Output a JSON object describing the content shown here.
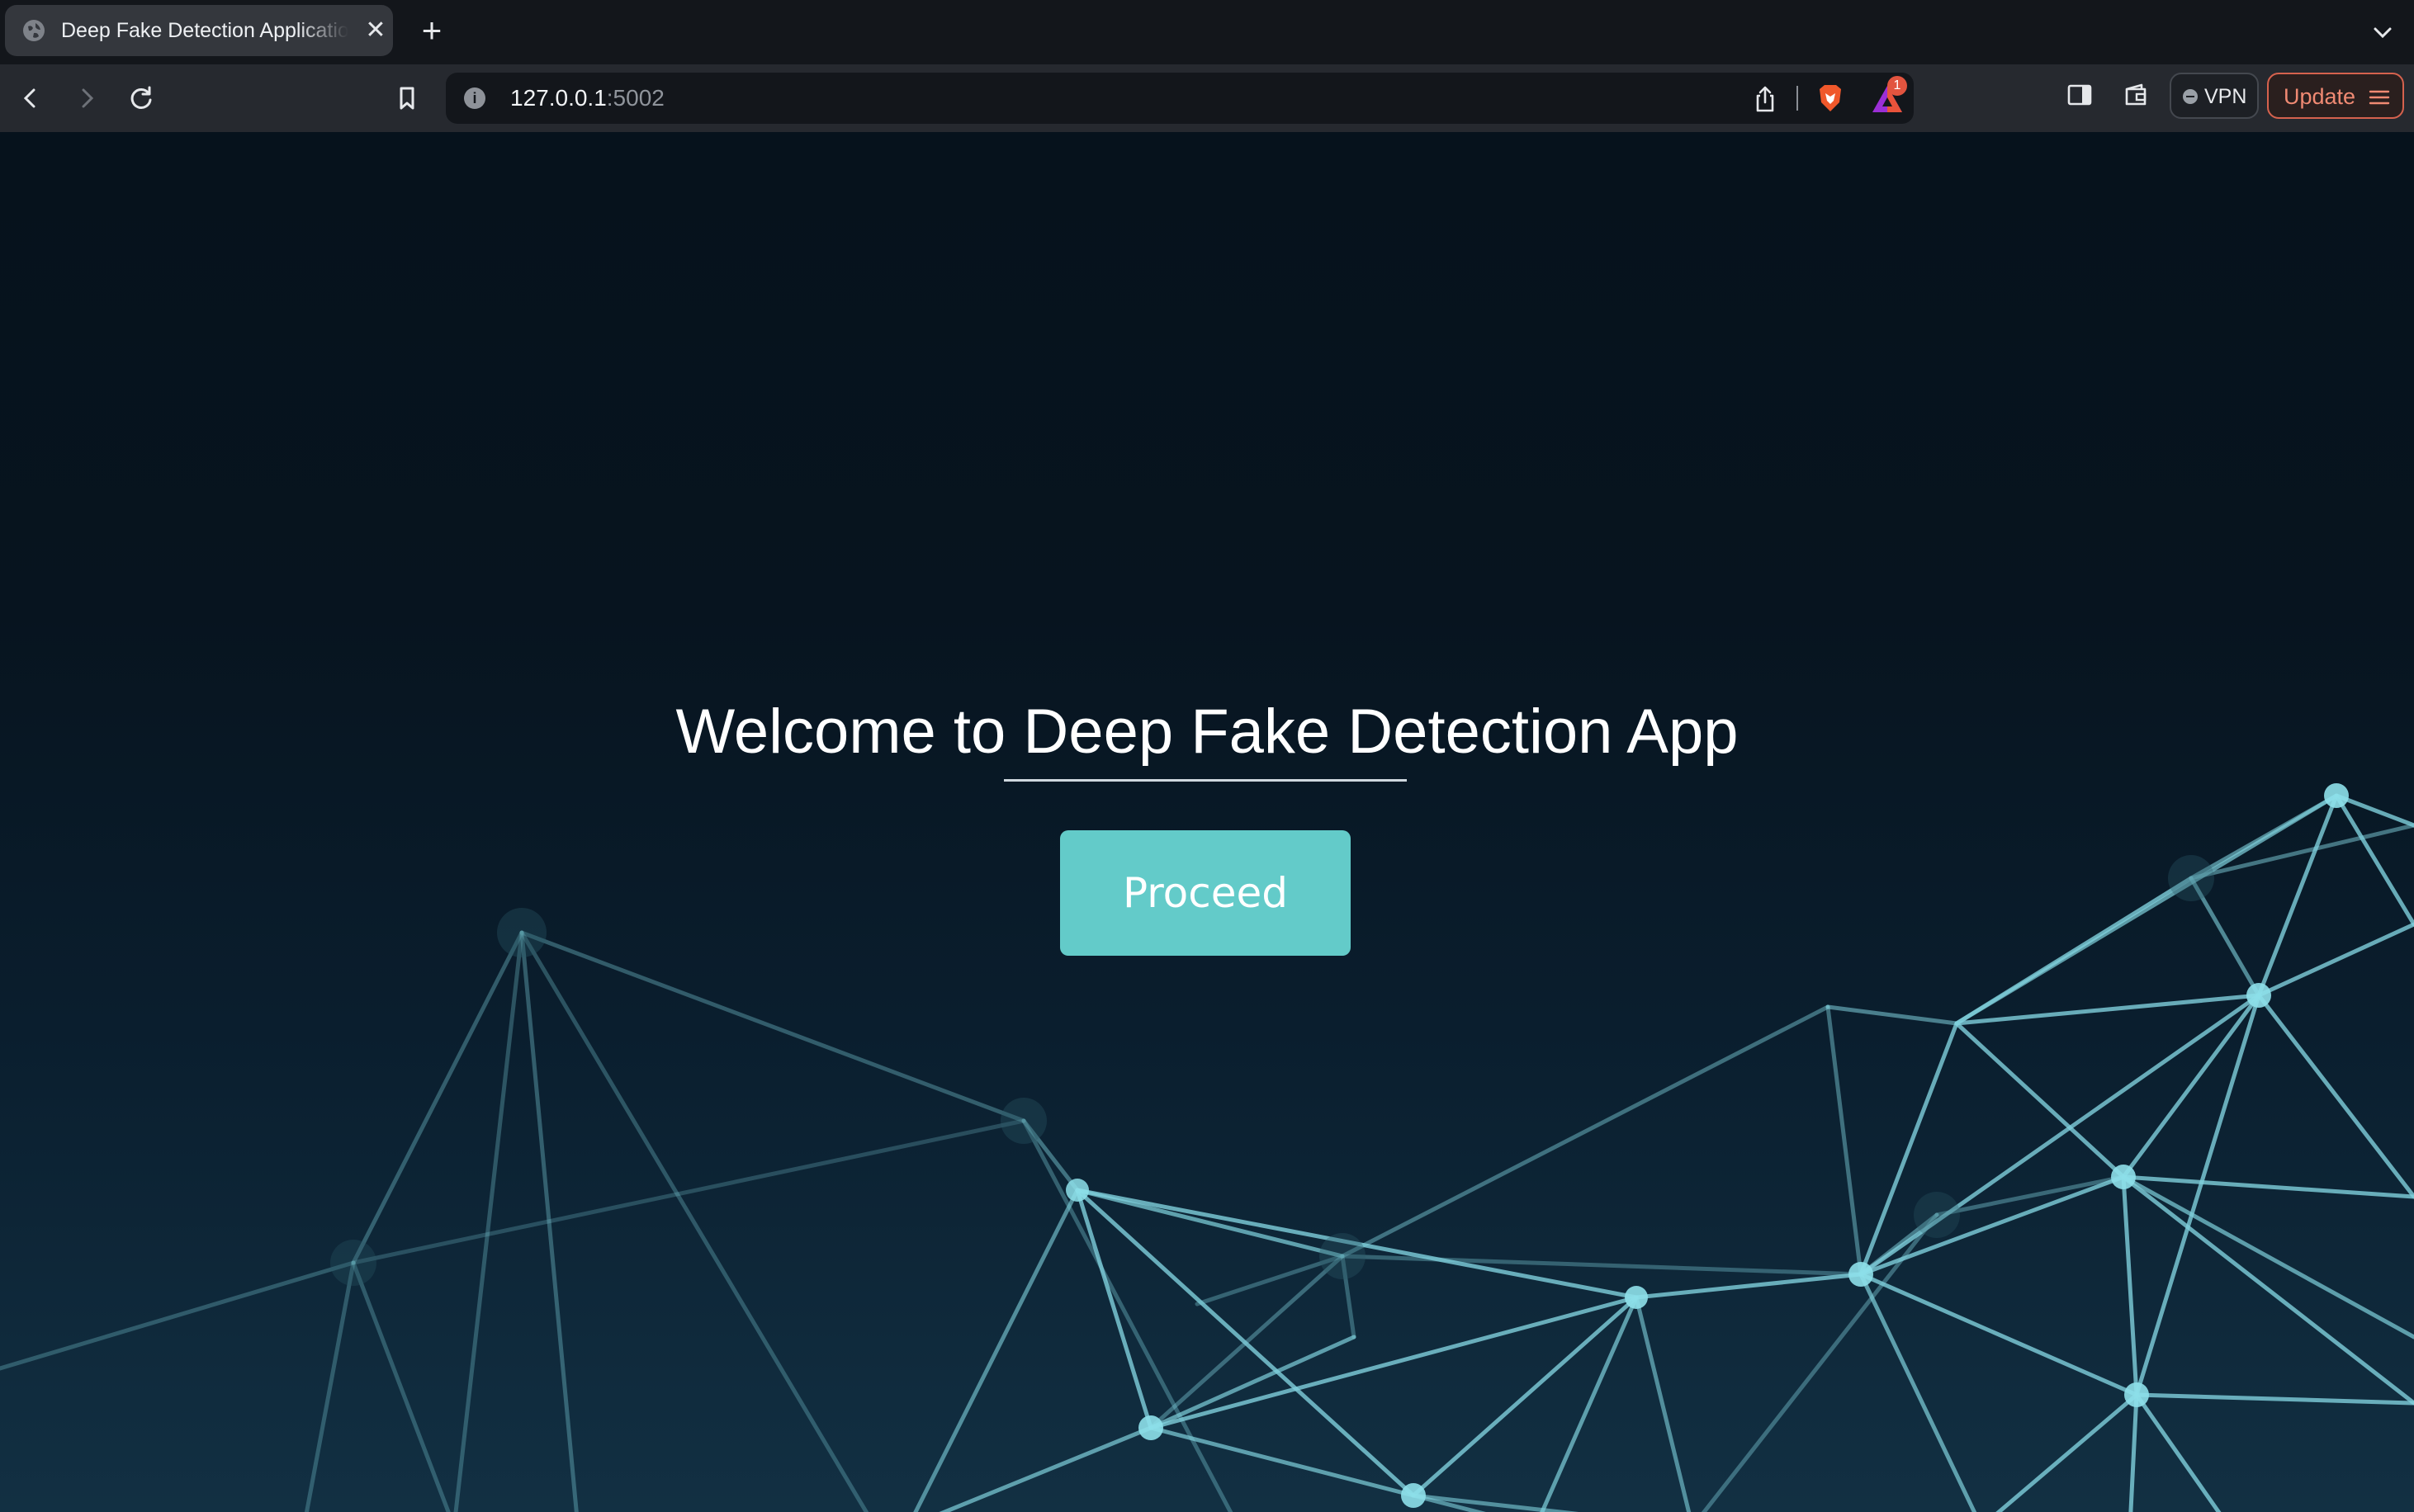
{
  "browser": {
    "tab": {
      "title": "Deep Fake Detection Application",
      "favicon_icon": "globe-icon",
      "close_icon": "close-icon"
    },
    "new_tab_icon": "plus-icon",
    "tab_list_icon": "chevron-down-icon",
    "toolbar": {
      "back_icon": "back-arrow-icon",
      "forward_icon": "forward-arrow-icon",
      "reload_icon": "reload-icon",
      "bookmark_icon": "bookmark-icon",
      "address": {
        "host": "127.0.0.1",
        "port": ":5002",
        "site_info_icon": "info-icon"
      },
      "share_icon": "share-icon",
      "shields_icon": "brave-lion-icon",
      "rewards_icon": "rewards-triangle-icon",
      "rewards_badge": "1",
      "sidebar_icon": "sidebar-icon",
      "wallet_icon": "wallet-icon",
      "vpn_label": "VPN",
      "update_label": "Update",
      "menu_icon": "hamburger-menu-icon"
    }
  },
  "page": {
    "heading": "Welcome to Deep Fake Detection App",
    "proceed_label": "Proceed",
    "background": "network-mesh",
    "colors": {
      "accent": "#63cbc9",
      "background_top": "#06121c",
      "background_bottom": "#123043",
      "mesh_line": "#7fd0dc"
    }
  }
}
